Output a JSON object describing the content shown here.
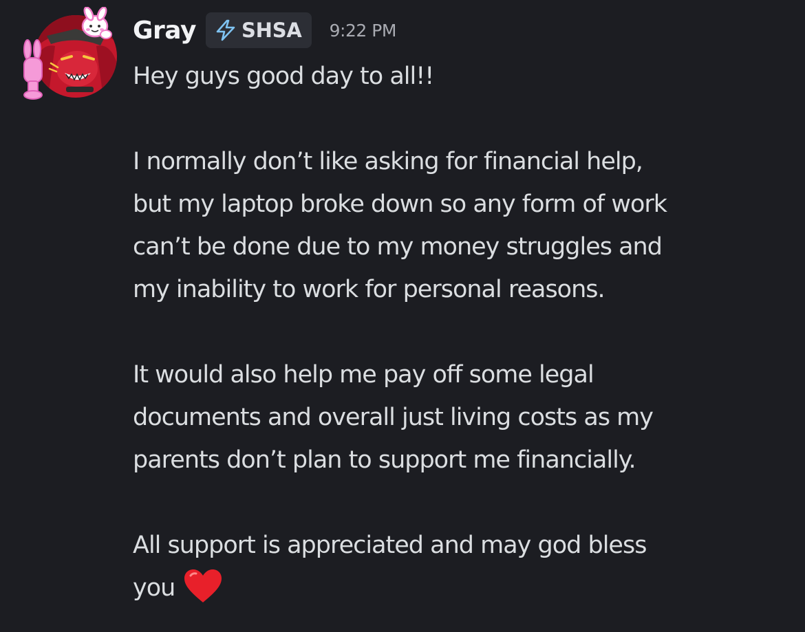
{
  "message": {
    "author": {
      "name": "Gray",
      "avatar": "avatar-red-haired-character",
      "decoration": "pink-bunny-decoration",
      "tag": {
        "icon": "lightning-icon",
        "label": "SHSA"
      }
    },
    "timestamp": "9:22 PM",
    "paragraphs": [
      "Hey guys good day to all!!",
      "I normally don’t like asking for financial help,\nbut my laptop broke down so any form of work\ncan’t be done due to my money struggles and\nmy inability to work for personal reasons.",
      "It would also help me pay off some legal\ndocuments and overall just living costs as my\nparents don’t plan to support me financially.",
      "All support is appreciated and may god bless\nyou"
    ],
    "trailing_emoji": "red-heart-icon"
  },
  "colors": {
    "background": "#1c1d22",
    "text": "#dbdee1",
    "username": "#f2f3f5",
    "timestamp": "#a9abb2",
    "tag_background": "#2c2e35",
    "heart": "#e8202a",
    "avatar_ring": "#c4182c",
    "bunny": "#f59ad8"
  }
}
